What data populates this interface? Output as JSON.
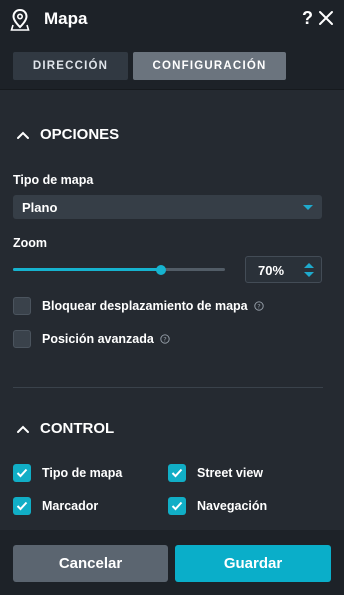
{
  "header": {
    "title": "Mapa",
    "help_label": "?",
    "icons": {
      "map": "map-pin-icon",
      "close": "close-icon"
    }
  },
  "tabs": [
    {
      "label": "DIRECCIÓN",
      "active": false
    },
    {
      "label": "CONFIGURACIÓN",
      "active": true
    }
  ],
  "options": {
    "title": "OPCIONES",
    "map_type_label": "Tipo de mapa",
    "map_type_value": "Plano",
    "zoom_label": "Zoom",
    "zoom_value": "70%",
    "zoom_fraction": 0.7,
    "checkboxes": [
      {
        "label": "Bloquear desplazamiento de mapa",
        "checked": false,
        "info": true
      },
      {
        "label": "Posición avanzada",
        "checked": false,
        "info": true
      }
    ]
  },
  "control": {
    "title": "CONTROL",
    "checkboxes": [
      {
        "label": "Tipo de mapa",
        "checked": true
      },
      {
        "label": "Street view",
        "checked": true
      },
      {
        "label": "Marcador",
        "checked": true
      },
      {
        "label": "Navegación",
        "checked": true
      }
    ]
  },
  "footer": {
    "cancel_label": "Cancelar",
    "save_label": "Guardar"
  },
  "colors": {
    "accent": "#11aec6",
    "background": "#252a31",
    "header": "#1d2228",
    "active_tab": "#6b747e",
    "cancel": "#5b6570"
  }
}
